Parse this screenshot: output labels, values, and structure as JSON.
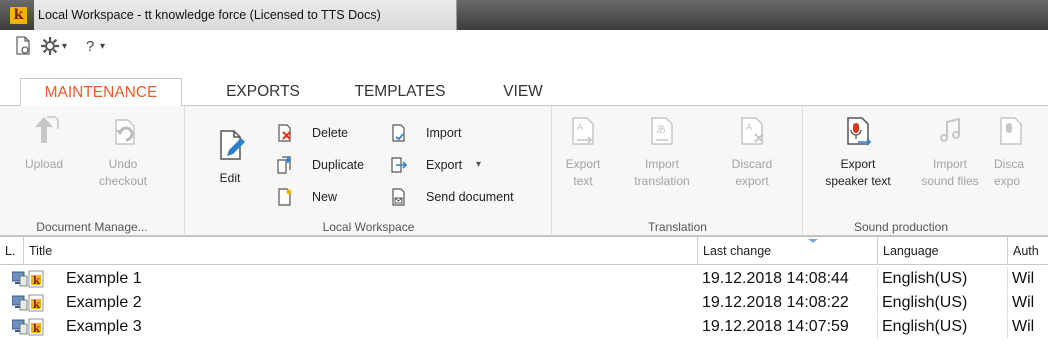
{
  "window": {
    "app_icon_letter": "k",
    "title": "Local Workspace - tt knowledge force (Licensed to TTS Docs)"
  },
  "qat": {
    "help_label": "?",
    "dropdown_glyph": "▾"
  },
  "tabs": [
    {
      "label": "MAINTENANCE",
      "active": true
    },
    {
      "label": "EXPORTS",
      "active": false
    },
    {
      "label": "TEMPLATES",
      "active": false
    },
    {
      "label": "VIEW",
      "active": false
    }
  ],
  "ribbon": {
    "document_management": {
      "label": "Document Manage...",
      "upload": "Upload",
      "undo_checkout_line1": "Undo",
      "undo_checkout_line2": "checkout"
    },
    "local_workspace": {
      "label": "Local Workspace",
      "edit": "Edit",
      "delete": "Delete",
      "duplicate": "Duplicate",
      "new": "New",
      "import": "Import",
      "export": "Export",
      "export_dropdown": "▾",
      "send_document": "Send document"
    },
    "translation": {
      "label": "Translation",
      "export_text_line1": "Export",
      "export_text_line2": "text",
      "import_translation_line1": "Import",
      "import_translation_line2": "translation",
      "discard_export_line1": "Discard",
      "discard_export_line2": "export"
    },
    "sound_production": {
      "label": "Sound production",
      "export_speaker_line1": "Export",
      "export_speaker_line2": "speaker text",
      "import_sound_line1": "Import",
      "import_sound_line2": "sound files",
      "discard_line1": "Disca",
      "discard_line2": "expo"
    }
  },
  "grid": {
    "columns": {
      "lock": "L.",
      "title": "Title",
      "last_change": "Last change",
      "language": "Language",
      "author": "Auth"
    },
    "rows": [
      {
        "title": "Example 1",
        "last_change": "19.12.2018 14:08:44",
        "language": "English(US)",
        "author": "Wil"
      },
      {
        "title": "Example 2",
        "last_change": "19.12.2018 14:08:22",
        "language": "English(US)",
        "author": "Wil"
      },
      {
        "title": "Example 3",
        "last_change": "19.12.2018 14:07:59",
        "language": "English(US)",
        "author": "Wil"
      }
    ]
  },
  "colors": {
    "active_tab": "#e85d2a",
    "titlebar": "#3c3c3c",
    "disabled_text": "#a3a3a3"
  }
}
